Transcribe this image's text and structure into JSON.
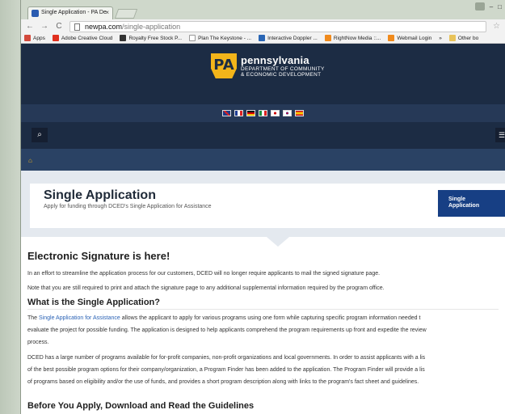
{
  "browser": {
    "tab_title": "Single Application - PA De",
    "tab_close": "×",
    "url_host": "newpa.com",
    "url_path": "/single-application",
    "bookmarks": [
      {
        "label": "Apps",
        "color": "#d34a3c"
      },
      {
        "label": "Adobe Creative Cloud",
        "color": "#e0301e"
      },
      {
        "label": "Royalty Free Stock P...",
        "color": "#333333"
      },
      {
        "label": "Plan The Keystone - ...",
        "color": "#ffffff"
      },
      {
        "label": "Interactive Doppler ...",
        "color": "#2a66b5"
      },
      {
        "label": "RightNow Media ::...",
        "color": "#f08a1c"
      },
      {
        "label": "Webmail Login",
        "color": "#f08a1c"
      },
      {
        "label": "»",
        "color": ""
      },
      {
        "label": "Other bo",
        "color": "#e8c35a"
      }
    ]
  },
  "site": {
    "logo_letters": "PA",
    "state_name": "pennsylvania",
    "dept_line1": "DEPARTMENT OF COMMUNITY",
    "dept_line2": "& ECONOMIC DEVELOPMENT",
    "flags": [
      "uk",
      "france",
      "germany",
      "italy",
      "japan",
      "korea",
      "spain"
    ]
  },
  "hero": {
    "title": "Single Application",
    "subtitle": "Apply for funding through DCED's Single Application for Assistance",
    "button_line1": "Single",
    "button_line2": "Application"
  },
  "content": {
    "h_signature": "Electronic Signature is here!",
    "p_signature_1": "In an effort to streamline the application process for our customers, DCED will no longer require applicants to mail the signed signature page.",
    "p_signature_2": "Note that you are still required to print and attach the signature page to any additional supplemental information required by the program office.",
    "h_what": "What is the Single Application?",
    "p_what_1_pre": "The ",
    "p_what_1_link": "Single Application for Assistance",
    "p_what_1_post": " allows the applicant to apply for various programs using one form while capturing specific program information needed t",
    "p_what_2": "evaluate the project for possible funding. The application is designed to help applicants comprehend the program requirements up front and expedite the review",
    "p_what_3": "process.",
    "p_dced_1": "DCED has a large number of programs available for for-profit companies, non-profit organizations and local governments. In order to assist applicants with a lis",
    "p_dced_2": "of the best possible program options for their company/organization, a Program Finder has been added to the application. The Program Finder will provide a lis",
    "p_dced_3": "of programs based on eligibility and/or the use of funds, and provides a short program description along with links to the program's fact sheet and guidelines.",
    "h_before": "Before You Apply, Download and Read the Guidelines"
  }
}
